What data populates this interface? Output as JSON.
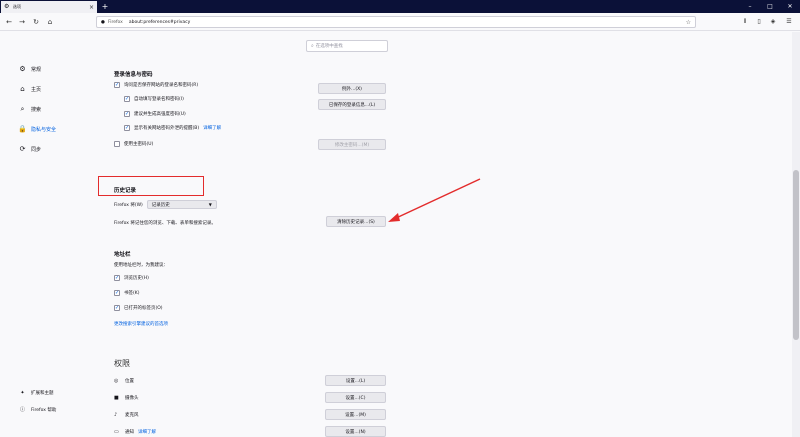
{
  "browser": {
    "tab_title": "选项",
    "url_brand": "Firefox",
    "url": "about:preferences#privacy"
  },
  "search": {
    "placeholder": "在选项中查找"
  },
  "sidebar": {
    "items": [
      {
        "label": "常规",
        "icon": "gear-icon"
      },
      {
        "label": "主页",
        "icon": "home-icon"
      },
      {
        "label": "搜索",
        "icon": "search-icon"
      },
      {
        "label": "隐私与安全",
        "icon": "lock-icon"
      },
      {
        "label": "同步",
        "icon": "sync-icon"
      }
    ],
    "bottom": [
      {
        "label": "扩展和主题",
        "icon": "puzzle-icon"
      },
      {
        "label": "Firefox 帮助",
        "icon": "help-icon"
      }
    ]
  },
  "logins": {
    "heading": "登录信息与密码",
    "ask_save": "询问是否保存网站的登录名和密码(R)",
    "autofill": "自动填写登录名和密码(I)",
    "suggest": "建议并生成高强度密码(U)",
    "breach": "显示有关网站密码外泄的提醒(B)",
    "learn_more": "详细了解",
    "master": "使用主密码(U)",
    "exceptions_btn": "例外...(X)",
    "saved_btn": "已保存的登录信息...(L)",
    "change_master_btn": "修改主密码...(M)"
  },
  "history": {
    "heading": "历史记录",
    "will_label": "Firefox 将(W)",
    "select_value": "记录历史",
    "desc": "Firefox 将记住您的浏览、下载、表单和搜索记录。",
    "clear_btn": "清除历史记录...(S)"
  },
  "addressbar": {
    "heading": "地址栏",
    "desc": "使用地址栏时，为我建议：",
    "opt1": "浏览历史(H)",
    "opt2": "书签(K)",
    "opt3": "已打开的标签页(O)",
    "link": "更改搜索引擎建议的首选项"
  },
  "permissions": {
    "heading": "权限",
    "items": [
      {
        "label": "位置",
        "button": "设置...(L)",
        "icon": "location-icon"
      },
      {
        "label": "摄像头",
        "button": "设置...(C)",
        "icon": "camera-icon"
      },
      {
        "label": "麦克风",
        "button": "设置...(M)",
        "icon": "microphone-icon"
      },
      {
        "label": "通知",
        "link": "详细了解",
        "button": "设置...(N)",
        "icon": "notification-icon"
      }
    ]
  },
  "colors": {
    "accent": "#0061e0",
    "highlight": "#e32c2c",
    "tabbar": "#0b1138"
  }
}
